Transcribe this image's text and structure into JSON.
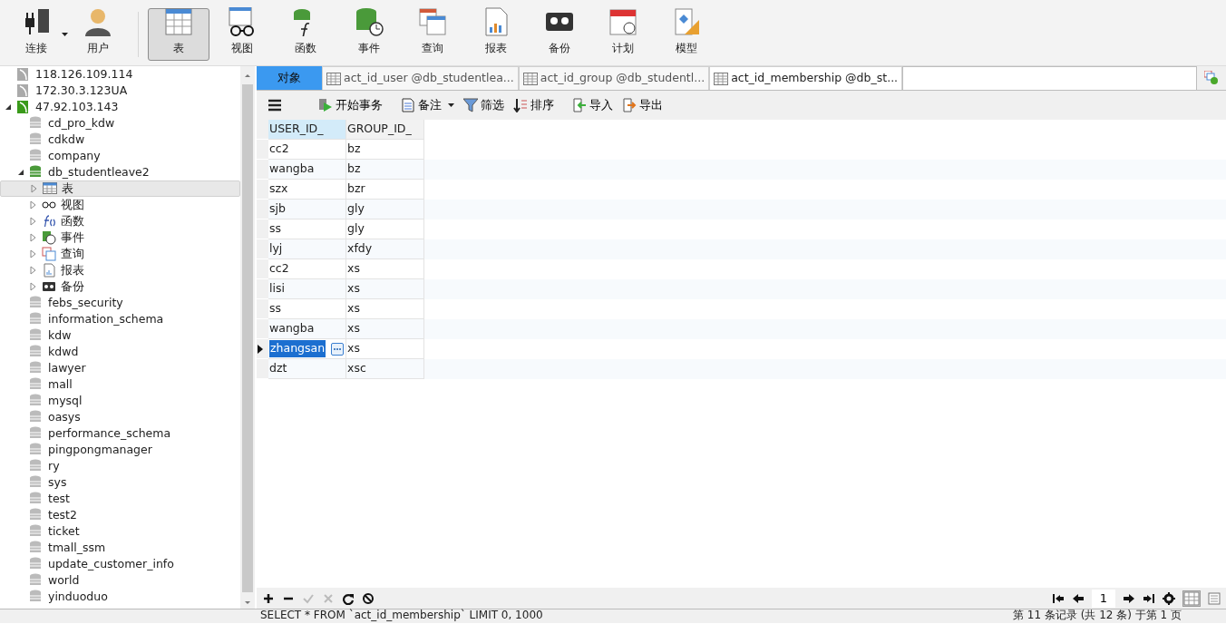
{
  "toolbar": {
    "buttons": [
      {
        "label": "连接",
        "selected": false,
        "dropdown": true
      },
      {
        "label": "用户",
        "selected": false
      },
      {
        "label": "表",
        "selected": true
      },
      {
        "label": "视图",
        "selected": false
      },
      {
        "label": "函数",
        "selected": false
      },
      {
        "label": "事件",
        "selected": false
      },
      {
        "label": "查询",
        "selected": false
      },
      {
        "label": "报表",
        "selected": false
      },
      {
        "label": "备份",
        "selected": false
      },
      {
        "label": "计划",
        "selected": false
      },
      {
        "label": "模型",
        "selected": false
      }
    ]
  },
  "sidebar": {
    "items": [
      {
        "kind": "server",
        "label": "118.126.109.114",
        "open": false,
        "selected": false
      },
      {
        "kind": "server",
        "label": "172.30.3.123UA",
        "open": false,
        "selected": false
      },
      {
        "kind": "server",
        "label": "47.92.103.143",
        "open": true,
        "expanded": true,
        "selected": false,
        "children": [
          {
            "kind": "database",
            "label": "cd_pro_kdw",
            "open": false,
            "selected": false
          },
          {
            "kind": "database",
            "label": "cdkdw",
            "open": false,
            "selected": false
          },
          {
            "kind": "database",
            "label": "company",
            "open": false,
            "selected": false
          },
          {
            "kind": "database",
            "label": "db_studentleave2",
            "open": true,
            "expanded": true,
            "selected": false,
            "children": [
              {
                "kind": "tables",
                "label": "表",
                "expanded": false,
                "selected": true
              },
              {
                "kind": "views",
                "label": "视图",
                "expanded": false,
                "selected": false
              },
              {
                "kind": "functions",
                "label": "函数",
                "expanded": false,
                "selected": false
              },
              {
                "kind": "events",
                "label": "事件",
                "expanded": false,
                "selected": false
              },
              {
                "kind": "queries",
                "label": "查询",
                "expanded": false,
                "selected": false
              },
              {
                "kind": "reports",
                "label": "报表",
                "expanded": false,
                "selected": false
              },
              {
                "kind": "backups",
                "label": "备份",
                "expanded": false,
                "selected": false
              }
            ]
          },
          {
            "kind": "database",
            "label": "febs_security",
            "open": false,
            "selected": false
          },
          {
            "kind": "database",
            "label": "information_schema",
            "open": false,
            "selected": false
          },
          {
            "kind": "database",
            "label": "kdw",
            "open": false,
            "selected": false
          },
          {
            "kind": "database",
            "label": "kdwd",
            "open": false,
            "selected": false
          },
          {
            "kind": "database",
            "label": "lawyer",
            "open": false,
            "selected": false
          },
          {
            "kind": "database",
            "label": "mall",
            "open": false,
            "selected": false
          },
          {
            "kind": "database",
            "label": "mysql",
            "open": false,
            "selected": false
          },
          {
            "kind": "database",
            "label": "oasys",
            "open": false,
            "selected": false
          },
          {
            "kind": "database",
            "label": "performance_schema",
            "open": false,
            "selected": false
          },
          {
            "kind": "database",
            "label": "pingpongmanager",
            "open": false,
            "selected": false
          },
          {
            "kind": "database",
            "label": "ry",
            "open": false,
            "selected": false
          },
          {
            "kind": "database",
            "label": "sys",
            "open": false,
            "selected": false
          },
          {
            "kind": "database",
            "label": "test",
            "open": false,
            "selected": false
          },
          {
            "kind": "database",
            "label": "test2",
            "open": false,
            "selected": false
          },
          {
            "kind": "database",
            "label": "ticket",
            "open": false,
            "selected": false
          },
          {
            "kind": "database",
            "label": "tmall_ssm",
            "open": false,
            "selected": false
          },
          {
            "kind": "database",
            "label": "update_customer_info",
            "open": false,
            "selected": false
          },
          {
            "kind": "database",
            "label": "world",
            "open": false,
            "selected": false
          },
          {
            "kind": "database",
            "label": "yinduoduo",
            "open": false,
            "selected": false
          }
        ]
      }
    ]
  },
  "object_tab": {
    "label": "对象",
    "selected": false
  },
  "tabs": [
    {
      "label": "act_id_user @db_studentlea...",
      "selected": false
    },
    {
      "label": "act_id_group @db_studentl...",
      "selected": false
    },
    {
      "label": "act_id_membership @db_st...",
      "selected": true
    }
  ],
  "table_toolbar": [
    {
      "kind": "menu"
    },
    {
      "kind": "transaction",
      "label": "开始事务"
    },
    {
      "kind": "note",
      "label": "备注",
      "dropdown": true
    },
    {
      "kind": "filter",
      "label": "筛选"
    },
    {
      "kind": "sort",
      "label": "排序"
    },
    {
      "kind": "import",
      "label": "导入"
    },
    {
      "kind": "export",
      "label": "导出"
    }
  ],
  "table": {
    "columns": [
      {
        "label": "USER_ID_",
        "selected": true
      },
      {
        "label": "GROUP_ID_",
        "selected": false
      }
    ],
    "rows": [
      {
        "cells": [
          "cc2",
          "bz"
        ],
        "selected": false
      },
      {
        "cells": [
          "wangba",
          "bz"
        ],
        "selected": false
      },
      {
        "cells": [
          "szx",
          "bzr"
        ],
        "selected": false
      },
      {
        "cells": [
          "sjb",
          "gly"
        ],
        "selected": false
      },
      {
        "cells": [
          "ss",
          "gly"
        ],
        "selected": false
      },
      {
        "cells": [
          "lyj",
          "xfdy"
        ],
        "selected": false
      },
      {
        "cells": [
          "cc2",
          "xs"
        ],
        "selected": false
      },
      {
        "cells": [
          "lisi",
          "xs"
        ],
        "selected": false
      },
      {
        "cells": [
          "ss",
          "xs"
        ],
        "selected": false
      },
      {
        "cells": [
          "wangba",
          "xs"
        ],
        "selected": false
      },
      {
        "cells": [
          "zhangsan",
          "xs"
        ],
        "selected": true
      },
      {
        "cells": [
          "dzt",
          "xsc"
        ],
        "selected": false
      }
    ]
  },
  "bottom_bar": {
    "page": "1"
  },
  "status_bar": {
    "sql": "SELECT * FROM `act_id_membership` LIMIT 0, 1000",
    "records": "第 11 条记录 (共 12 条) 于第 1 页"
  }
}
